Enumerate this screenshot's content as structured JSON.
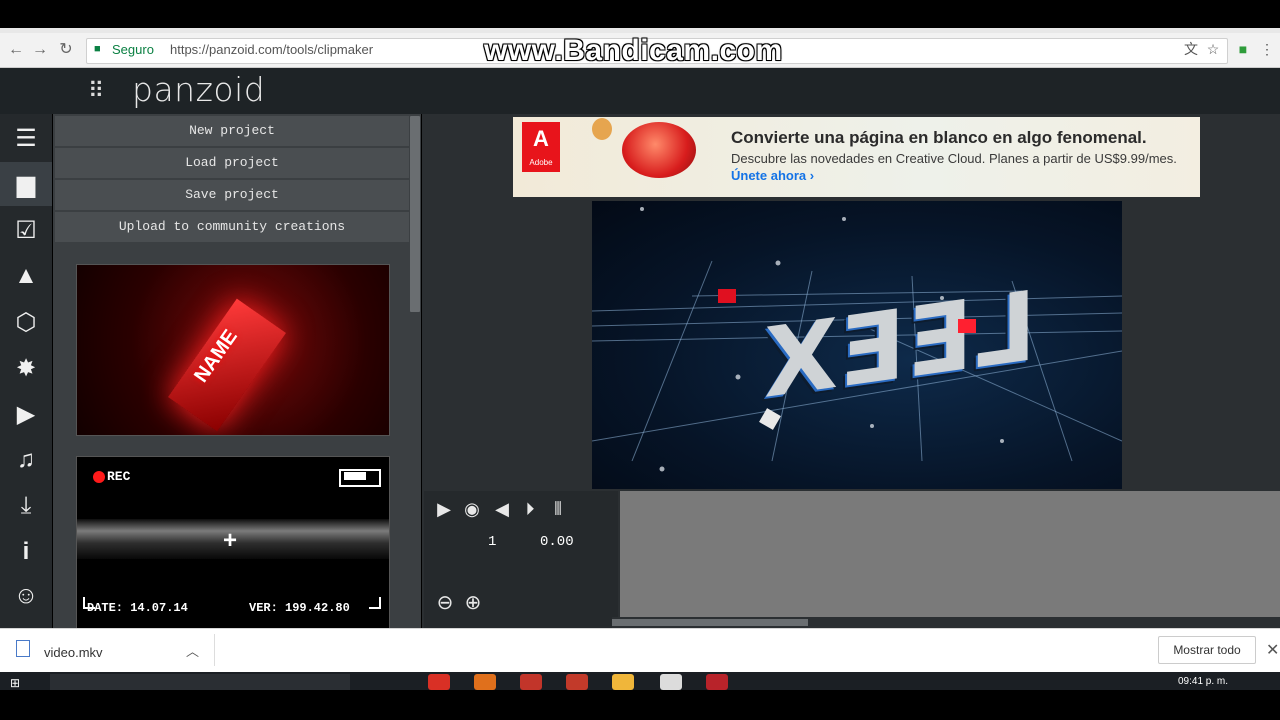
{
  "browser": {
    "secure_label": "Seguro",
    "url": "https://panzoid.com/tools/clipmaker",
    "watermark": "www.Bandicam.com"
  },
  "app": {
    "logo": "panzoid",
    "grid_icon": "apps-grid-icon"
  },
  "rail": {
    "items": [
      {
        "name": "menu-icon",
        "glyph": "☰"
      },
      {
        "name": "folder-icon",
        "glyph": "▆"
      },
      {
        "name": "checkbox-icon",
        "glyph": "☑"
      },
      {
        "name": "image-icon",
        "glyph": "▲"
      },
      {
        "name": "cube-icon",
        "glyph": "⬡"
      },
      {
        "name": "burst-icon",
        "glyph": "✸"
      },
      {
        "name": "camera-icon",
        "glyph": "▶"
      },
      {
        "name": "music-icon",
        "glyph": "♫"
      },
      {
        "name": "download-icon",
        "glyph": "⤓"
      },
      {
        "name": "info-icon",
        "glyph": "i"
      },
      {
        "name": "smiley-icon",
        "glyph": "☺"
      }
    ]
  },
  "menu": {
    "new_project": "New project",
    "load_project": "Load project",
    "save_project": "Save project",
    "upload": "Upload to community creations"
  },
  "templates": {
    "thumb1_text": "NAME",
    "rec_label": "REC",
    "date_label": "DATE: 14.07.14",
    "ver_label": "VER: 199.42.80"
  },
  "ad": {
    "brand": "Adobe",
    "headline": "Convierte una página en blanco en algo fenomenal.",
    "subline": "Descubre las novedades en Creative Cloud. Planes a partir de US$9.99/mes.",
    "cta": "Únete ahora ›"
  },
  "scene": {
    "text": "LEEX"
  },
  "timeline": {
    "frame": "1",
    "time": "0.00"
  },
  "downloads": {
    "file_name": "video.mkv",
    "show_all": "Mostrar todo"
  },
  "taskbar": {
    "clock": "09:41 p. m."
  },
  "colors": {
    "accent_red": "#e8141b",
    "panel": "#3b3f42",
    "header": "#1e2326"
  }
}
